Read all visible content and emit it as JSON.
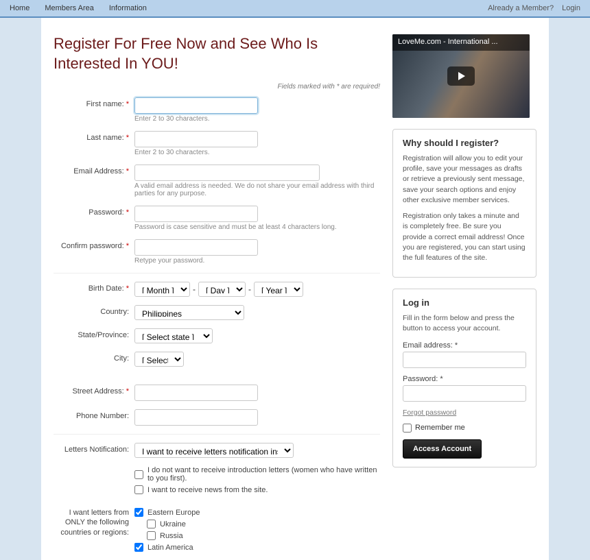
{
  "topbar": {
    "home": "Home",
    "members": "Members Area",
    "info": "Information",
    "already": "Already a Member?",
    "login": "Login"
  },
  "heading": "Register For Free Now and See Who Is Interested In YOU!",
  "req_note": "Fields marked with * are required!",
  "labels": {
    "first_name": "First name:",
    "last_name": "Last name:",
    "email": "Email Address:",
    "password": "Password:",
    "confirm": "Confirm password:",
    "birth": "Birth Date:",
    "country": "Country:",
    "state": "State/Province:",
    "city": "City:",
    "street": "Street Address:",
    "phone": "Phone Number:",
    "letters_notif": "Letters Notification:",
    "want_letters": "I want letters from ONLY the following countries or regions:"
  },
  "hints": {
    "name": "Enter 2 to 30 characters.",
    "email": "A valid email address is needed. We do not share your email address with third parties for any purpose.",
    "password": "Password is case sensitive and must be at least 4 characters long.",
    "confirm": "Retype your password."
  },
  "selects": {
    "month": "[ Month ]",
    "day": "[ Day ]",
    "year": "[ Year ]",
    "country_val": "Philippines",
    "state": "[ Select state ]",
    "city": "[ Select city ]",
    "letters_notif": "I want to receive letters notification instantly"
  },
  "checks": {
    "no_intro": "I do not want to receive introduction letters (women who have written to you first).",
    "news": "I want to receive news from the site.",
    "eastern_europe": "Eastern Europe",
    "ukraine": "Ukraine",
    "russia": "Russia",
    "latin_america": "Latin America"
  },
  "video": {
    "title": "LoveMe.com - International ..."
  },
  "why": {
    "title": "Why should I register?",
    "p1": "Registration will allow you to edit your profile, save your messages as drafts or retrieve a previously sent message, save your search options and enjoy other exclusive member services.",
    "p2": "Registration only takes a minute and is completely free. Be sure you provide a correct email address! Once you are registered, you can start using the full features of the site."
  },
  "login_panel": {
    "title": "Log in",
    "sub": "Fill in the form below and press the button to access your account.",
    "email_label": "Email address:",
    "pw_label": "Password:",
    "forgot": "Forgot password",
    "remember": "Remember me",
    "btn": "Access Account"
  },
  "ast": "*",
  "dash": "-"
}
